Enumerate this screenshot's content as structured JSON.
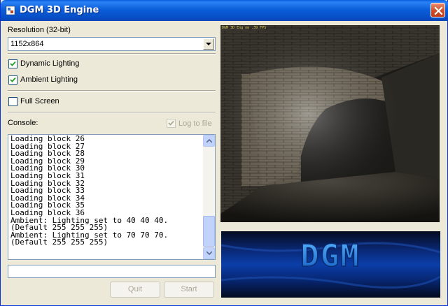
{
  "window": {
    "title": "DGM 3D Engine",
    "icon": "app-icon",
    "close_icon": "close-icon"
  },
  "settings": {
    "resolution_label": "Resolution (32-bit)",
    "resolution_value": "1152x864",
    "dynamic_lighting_label": "Dynamic Lighting",
    "dynamic_lighting_checked": true,
    "ambient_lighting_label": "Ambient Lighting",
    "ambient_lighting_checked": true,
    "full_screen_label": "Full Screen",
    "full_screen_checked": false
  },
  "console": {
    "label": "Console:",
    "log_to_file_label": "Log to file",
    "log_to_file_checked": true,
    "lines": [
      "Loading block 26",
      "Loading block 27",
      "Loading block 28",
      "Loading block 29",
      "Loading block 30",
      "Loading block 31",
      "Loading block 32",
      "Loading block 33",
      "Loading block 34",
      "Loading block 35",
      "Loading block 36",
      "Ambient: Lighting set to 40 40 40.",
      "(Default 255 255 255)",
      "Ambient: Lighting set to 70 70 70.",
      "(Default 255 255 255)"
    ],
    "command_value": ""
  },
  "buttons": {
    "quit_label": "Quit",
    "start_label": "Start"
  },
  "viewport": {
    "overlay_text": "DGM 3D Eng ne   .39 FPS"
  },
  "logo": {
    "text": "DGM"
  },
  "colors": {
    "titlebar": "#0a5fdb",
    "window_bg": "#ece9d8",
    "logo_text": "#1e7ad8"
  }
}
